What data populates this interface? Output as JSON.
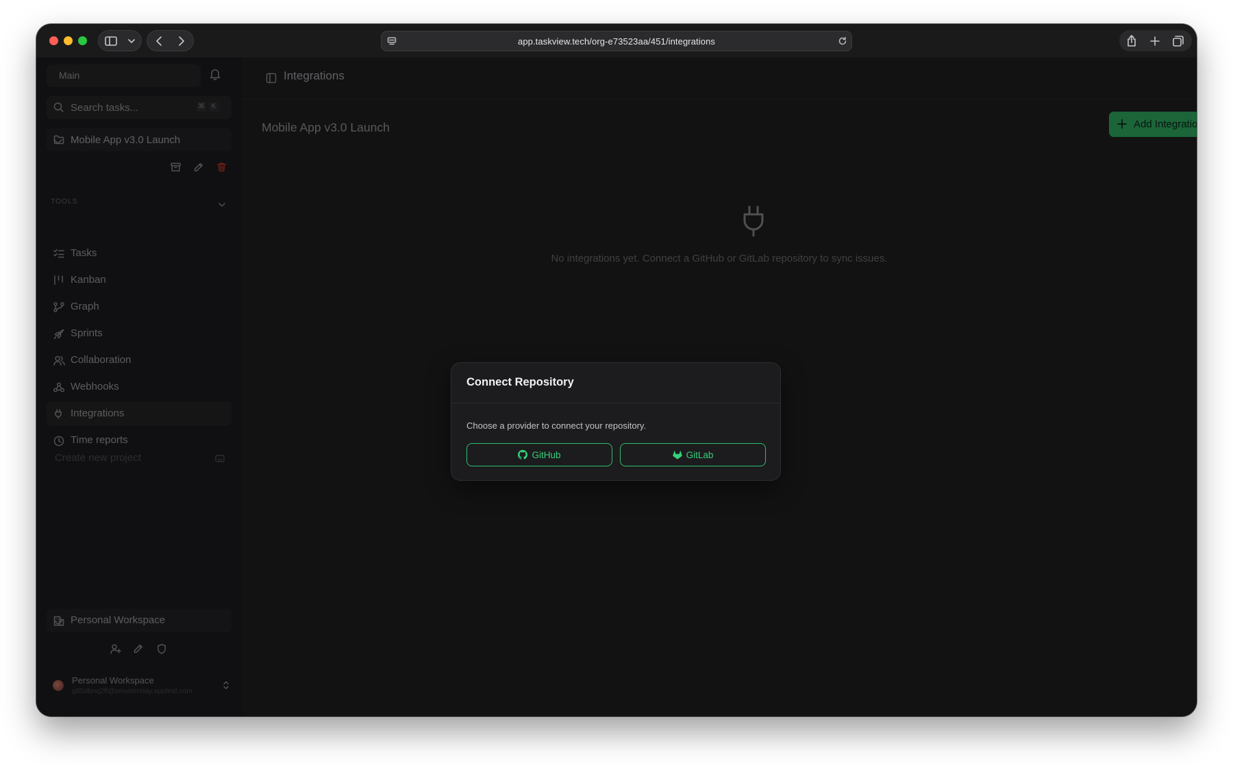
{
  "browser": {
    "url": "app.taskview.tech/org-e73523aa/451/integrations"
  },
  "sidebar": {
    "main_label": "Main",
    "search_placeholder": "Search tasks...",
    "search_shortcut": [
      "⌘",
      "K"
    ],
    "project_name": "Mobile App v3.0 Launch",
    "tools_heading": "TOOLS",
    "nav_items": [
      {
        "label": "Tasks",
        "icon": "list-checks-icon"
      },
      {
        "label": "Kanban",
        "icon": "kanban-icon"
      },
      {
        "label": "Graph",
        "icon": "graph-icon"
      },
      {
        "label": "Sprints",
        "icon": "rocket-icon"
      },
      {
        "label": "Collaboration",
        "icon": "users-icon"
      },
      {
        "label": "Webhooks",
        "icon": "webhook-icon"
      },
      {
        "label": "Integrations",
        "icon": "plug-icon",
        "active": true
      },
      {
        "label": "Time reports",
        "icon": "clock-icon"
      }
    ],
    "create_project_placeholder": "Create new project",
    "workspace_name": "Personal Workspace",
    "user": {
      "workspace": "Personal Workspace",
      "email": "g85dbnq2ff@privaterelay.appleid.com"
    }
  },
  "main": {
    "header_title": "Integrations",
    "project_title": "Mobile App v3.0 Launch",
    "add_button": "Add Integration",
    "empty_message": "No integrations yet. Connect a GitHub or GitLab repository to sync issues."
  },
  "dialog": {
    "title": "Connect Repository",
    "description": "Choose a provider to connect your repository.",
    "providers": [
      {
        "label": "GitHub",
        "icon": "github-icon"
      },
      {
        "label": "GitLab",
        "icon": "gitlab-icon"
      }
    ]
  },
  "colors": {
    "accent": "#2fbf6c",
    "accent_text": "#35d17a",
    "background": "#1f1f21",
    "destructive": "#c0392b"
  }
}
